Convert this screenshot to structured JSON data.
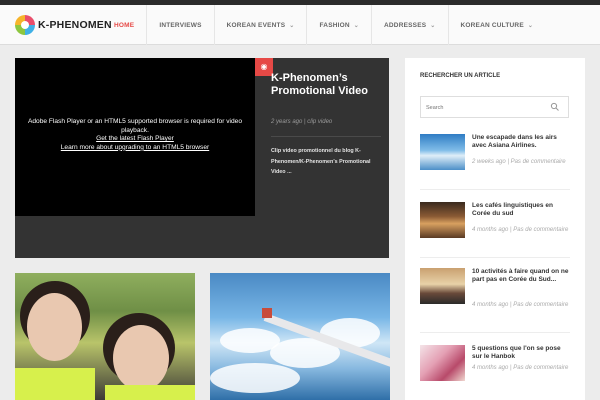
{
  "site": {
    "logo_text": "K-PHENOMEN"
  },
  "nav": [
    {
      "label": "HOME",
      "active": true,
      "dropdown": false
    },
    {
      "label": "INTERVIEWS",
      "active": false,
      "dropdown": false
    },
    {
      "label": "KOREAN EVENTS",
      "active": false,
      "dropdown": true
    },
    {
      "label": "FASHION",
      "active": false,
      "dropdown": true
    },
    {
      "label": "ADDRESSES",
      "active": false,
      "dropdown": true
    },
    {
      "label": "KOREAN CULTURE",
      "active": false,
      "dropdown": true
    }
  ],
  "feature": {
    "video_message": "Adobe Flash Player or an HTML5 supported browser is required for video playback.",
    "video_link_1": "Get the latest Flash Player",
    "video_link_2": "Learn more about upgrading to an HTML5 browser",
    "title": "K-Phenomen’s Promotional Video",
    "meta": "2 years ago | clip video",
    "excerpt": "Clip video promotionnel du blog K-Phenomen/K-Phenomen’s Promotional Video ...",
    "badge_icon": "camera-icon"
  },
  "sidebar": {
    "search_title": "RECHERCHER UN ARTICLE",
    "search_placeholder": "Search",
    "posts": [
      {
        "title": "Une escapade dans les airs avec Asiana Airlines.",
        "meta": "2 weeks ago | Pas de commentaire"
      },
      {
        "title": "Les cafés linguistiques en Corée du sud",
        "meta": "4 months ago | Pas de commentaire"
      },
      {
        "title": "10 activités à faire quand on ne part pas en Corée du Sud...",
        "meta": "4 months ago | Pas de commentaire"
      },
      {
        "title": "5 questions que l'on se pose sur le Hanbok",
        "meta": "4 months ago | Pas de commentaire"
      }
    ]
  },
  "colors": {
    "accent": "#e64946",
    "dark_panel": "#333333",
    "background": "#ececec"
  }
}
